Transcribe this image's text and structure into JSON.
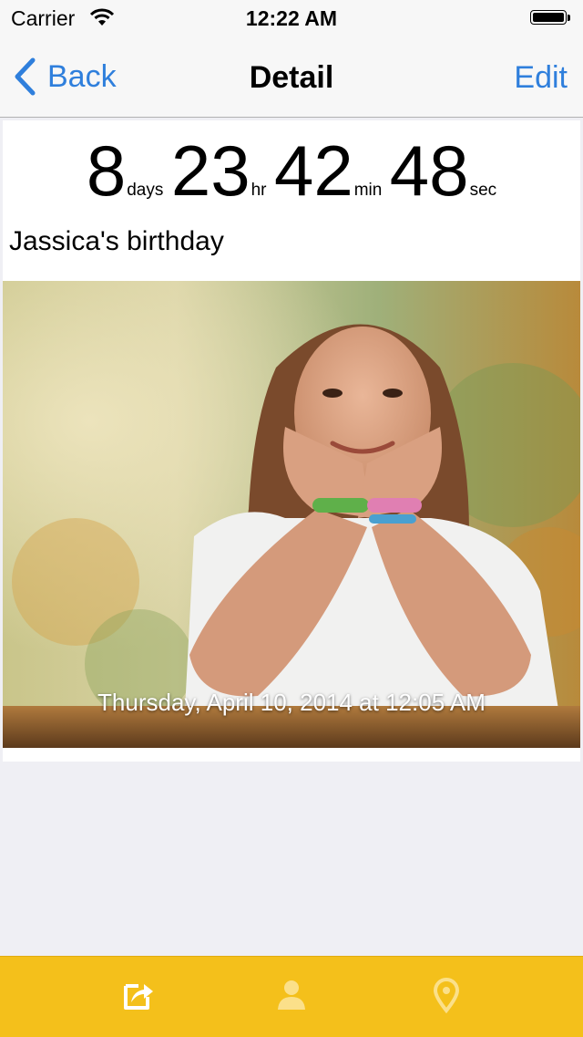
{
  "status_bar": {
    "carrier": "Carrier",
    "time": "12:22 AM",
    "icons": [
      "wifi-icon",
      "battery-icon"
    ]
  },
  "nav": {
    "back_label": "Back",
    "title": "Detail",
    "edit_label": "Edit",
    "accent_color": "#2f7fdc"
  },
  "countdown": {
    "days": "8",
    "days_label": "days",
    "hours": "23",
    "hours_label": "hr",
    "minutes": "42",
    "minutes_label": "min",
    "seconds": "48",
    "seconds_label": "sec"
  },
  "event": {
    "title": "Jassica's birthday",
    "photo_icon": "photo-image",
    "date_text": "Thursday, April 10, 2014 at 12:05 AM"
  },
  "tab_bar": {
    "background": "#f4c01b",
    "tabs": [
      {
        "icon": "share-icon",
        "active": true
      },
      {
        "icon": "person-icon",
        "active": false
      },
      {
        "icon": "location-pin-icon",
        "active": false
      }
    ]
  }
}
